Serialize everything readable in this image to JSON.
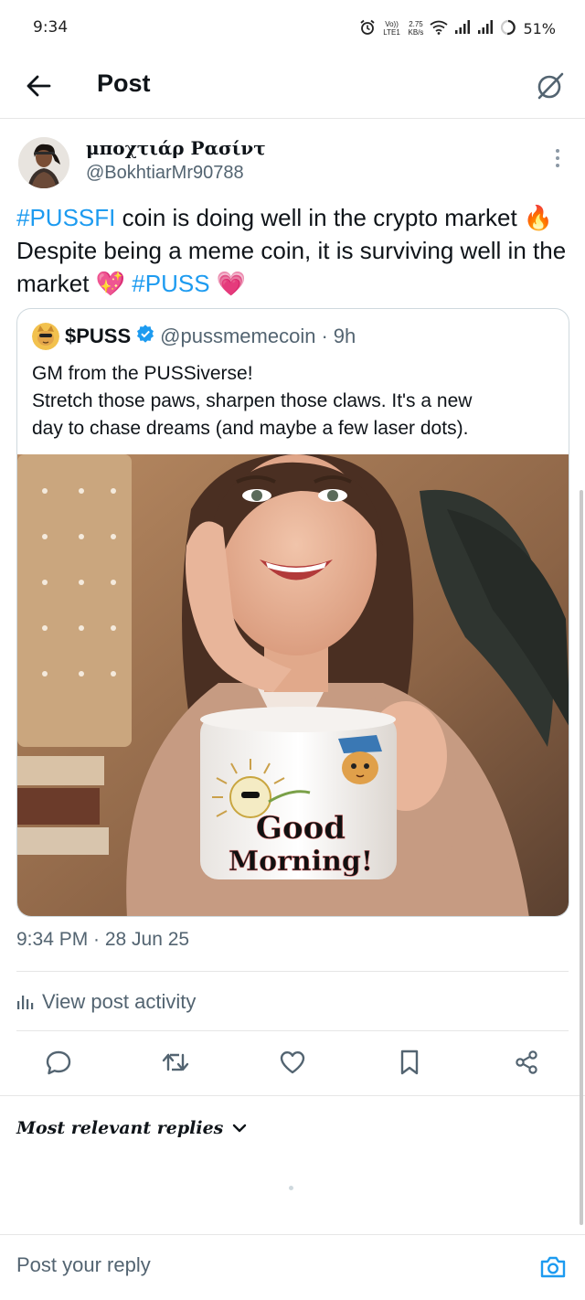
{
  "status_bar": {
    "time": "9:34",
    "network_label": "Vo)) LTE1",
    "speed_value": "2.75",
    "speed_unit": "KB/s",
    "battery": "51%"
  },
  "header": {
    "title": "Post",
    "back_icon": "arrow-left-icon",
    "grok_icon": "grok-icon"
  },
  "post": {
    "author_name": "μποχτιάρ Ρασίντ",
    "author_handle": "@BokhtiarMr90788",
    "text_segments": {
      "hashtag1": "#PUSSFI",
      "part1": " coin is doing well in the crypto market ",
      "emoji_fire": "🔥",
      "part2": " Despite being a meme coin, it is surviving well in the market ",
      "emoji_heart1": "💖",
      "space": " ",
      "hashtag2": "#PUSS",
      "emoji_heart2": "💗"
    },
    "quoted": {
      "name": "$PUSS",
      "handle": "@pussmemecoin",
      "separator": "·",
      "time": "9h",
      "line1": "GM from the PUSSiverse!",
      "line2": "Stretch those paws, sharpen those claws. It's a new",
      "line3": "day to chase dreams (and maybe a few laser dots).",
      "image_mug_text_1": "Good",
      "image_mug_text_2": "Morning!"
    },
    "timestamp": "9:34 PM · 28 Jun 25",
    "view_activity": "View post activity"
  },
  "actions": {
    "icons": [
      "reply-icon",
      "repost-icon",
      "like-icon",
      "bookmark-icon",
      "share-icon"
    ]
  },
  "replies": {
    "sort_label": "Most relevant replies"
  },
  "reply_bar": {
    "placeholder": "Post your reply"
  },
  "colors": {
    "link_blue": "#1d9bf0",
    "muted": "#536471",
    "verified": "#1d9bf0"
  }
}
